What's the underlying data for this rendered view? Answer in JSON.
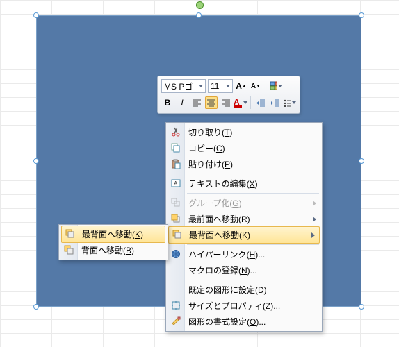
{
  "font": {
    "name": "MS Pゴ",
    "size": "11"
  },
  "mini_icons": {
    "grow": "A",
    "shrink": "A",
    "bold": "B",
    "italic": "I"
  },
  "menu": {
    "cut": {
      "label": "切り取り(",
      "m": "T",
      "tail": ")"
    },
    "copy": {
      "label": "コピー(",
      "m": "C",
      "tail": ")"
    },
    "paste": {
      "label": "貼り付け(",
      "m": "P",
      "tail": ")"
    },
    "edittext": {
      "label": "テキストの編集(",
      "m": "X",
      "tail": ")"
    },
    "group": {
      "label": "グループ化(",
      "m": "G",
      "tail": ")"
    },
    "bringfront": {
      "label": "最前面へ移動(",
      "m": "R",
      "tail": ")"
    },
    "sendback": {
      "label": "最背面へ移動(",
      "m": "K",
      "tail": ")"
    },
    "hyperlink": {
      "label": "ハイパーリンク(",
      "m": "H",
      "tail": ")..."
    },
    "macro": {
      "label": "マクロの登録(",
      "m": "N",
      "tail": ")..."
    },
    "default": {
      "label": "既定の図形に設定(",
      "m": "D",
      "tail": ")"
    },
    "size": {
      "label": "サイズとプロパティ(",
      "m": "Z",
      "tail": ")..."
    },
    "format": {
      "label": "図形の書式設定(",
      "m": "O",
      "tail": ")..."
    }
  },
  "submenu": {
    "sendtoback": {
      "label": "最背面へ移動(",
      "m": "K",
      "tail": ")"
    },
    "sendbackward": {
      "label": "背面へ移動(",
      "m": "B",
      "tail": ")"
    }
  }
}
